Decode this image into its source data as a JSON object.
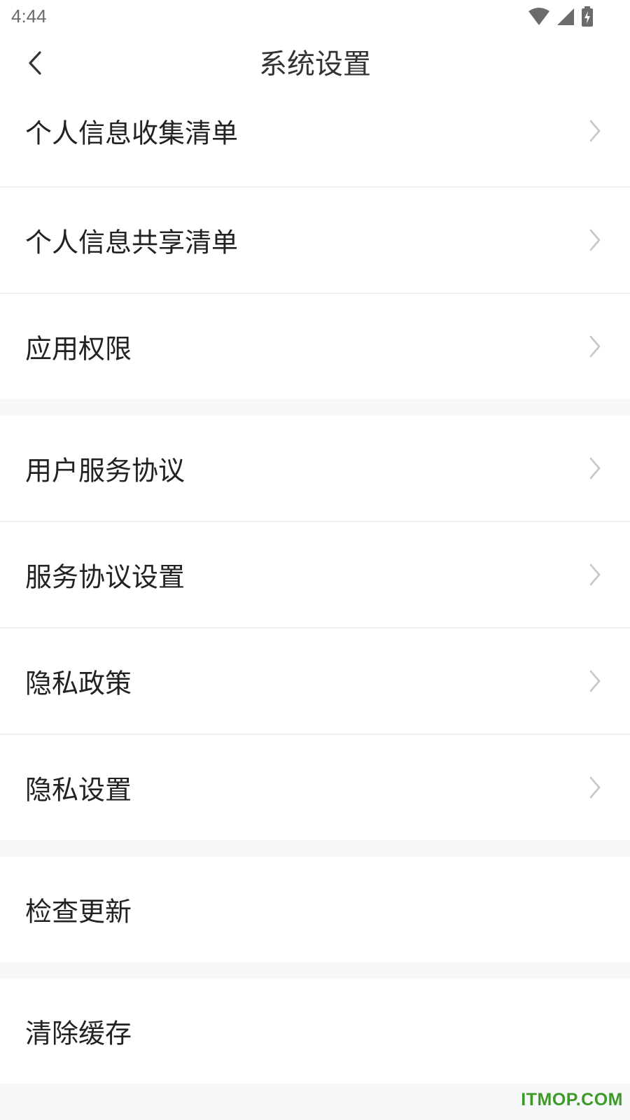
{
  "status_bar": {
    "time": "4:44",
    "icons": [
      "wifi-icon",
      "signal-icon",
      "battery-charging-icon"
    ]
  },
  "nav": {
    "title": "系统设置",
    "back_icon": "chevron-left-icon"
  },
  "groups": [
    {
      "items": [
        {
          "label": "个人信息收集清单",
          "chevron": true
        },
        {
          "label": "个人信息共享清单",
          "chevron": true
        },
        {
          "label": "应用权限",
          "chevron": true
        }
      ]
    },
    {
      "items": [
        {
          "label": "用户服务协议",
          "chevron": true
        },
        {
          "label": "服务协议设置",
          "chevron": true
        },
        {
          "label": "隐私政策",
          "chevron": true
        },
        {
          "label": "隐私设置",
          "chevron": true
        }
      ]
    },
    {
      "items": [
        {
          "label": "检查更新",
          "chevron": false
        }
      ]
    },
    {
      "items": [
        {
          "label": "清除缓存",
          "chevron": false
        }
      ]
    }
  ],
  "watermark": "ITMOP.COM",
  "colors": {
    "background": "#f7f8fa",
    "row_background": "#ffffff",
    "divider": "#eeeeee",
    "chevron": "#c7c7c7",
    "watermark": "#3e9a28"
  }
}
